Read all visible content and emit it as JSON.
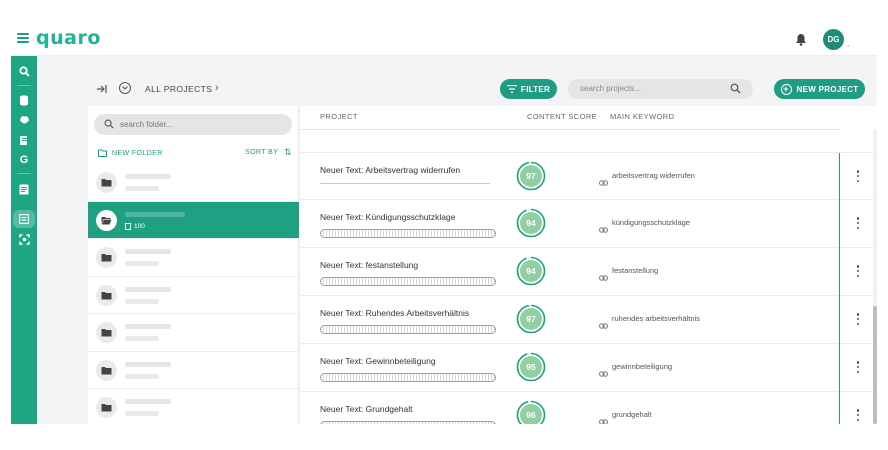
{
  "app": {
    "logo_text": "quaro",
    "avatar_initials": "DG"
  },
  "toolbar": {
    "breadcrumb": "ALL PROJECTS",
    "filter_label": "FILTER",
    "search_placeholder": "search projects...",
    "new_project_label": "NEW PROJECT"
  },
  "folders": {
    "search_placeholder": "search folder...",
    "new_folder_label": "NEW FOLDER",
    "sort_label": "SORT BY",
    "active_count": "100",
    "items": [
      {
        "active": false
      },
      {
        "active": true
      },
      {
        "active": false
      },
      {
        "active": false
      },
      {
        "active": false
      },
      {
        "active": false
      },
      {
        "active": false
      }
    ]
  },
  "table": {
    "headers": {
      "project": "PROJECT",
      "score": "CONTENT SCORE",
      "keyword": "MAIN KEYWORD"
    },
    "rows": [
      {
        "title": "Neuer Text: Arbeitsvertrag widerrufen",
        "score": "97",
        "keyword": "arbeitsvertrag widerrufen",
        "score_fraction": 0.97
      },
      {
        "title": "Neuer Text: Kündigungsschutzklage",
        "score": "94",
        "keyword": "kündigungsschutzklage",
        "score_fraction": 0.94
      },
      {
        "title": "Neuer Text: festanstellung",
        "score": "94",
        "keyword": "festanstellung",
        "score_fraction": 0.94
      },
      {
        "title": "Neuer Text: Ruhendes Arbeitsverhältnis",
        "score": "97",
        "keyword": "ruhendes arbeitsverhältnis",
        "score_fraction": 0.97
      },
      {
        "title": "Neuer Text: Gewinnbeteiligung",
        "score": "95",
        "keyword": "gewinnbeteiligung",
        "score_fraction": 0.95
      },
      {
        "title": "Neuer Text: Grundgehalt",
        "score": "96",
        "keyword": "grundgehalt",
        "score_fraction": 0.96
      }
    ]
  },
  "colors": {
    "accent": "#1f9d84",
    "score_fill": "#8fcfa1",
    "score_ring": "#1fa37a"
  }
}
